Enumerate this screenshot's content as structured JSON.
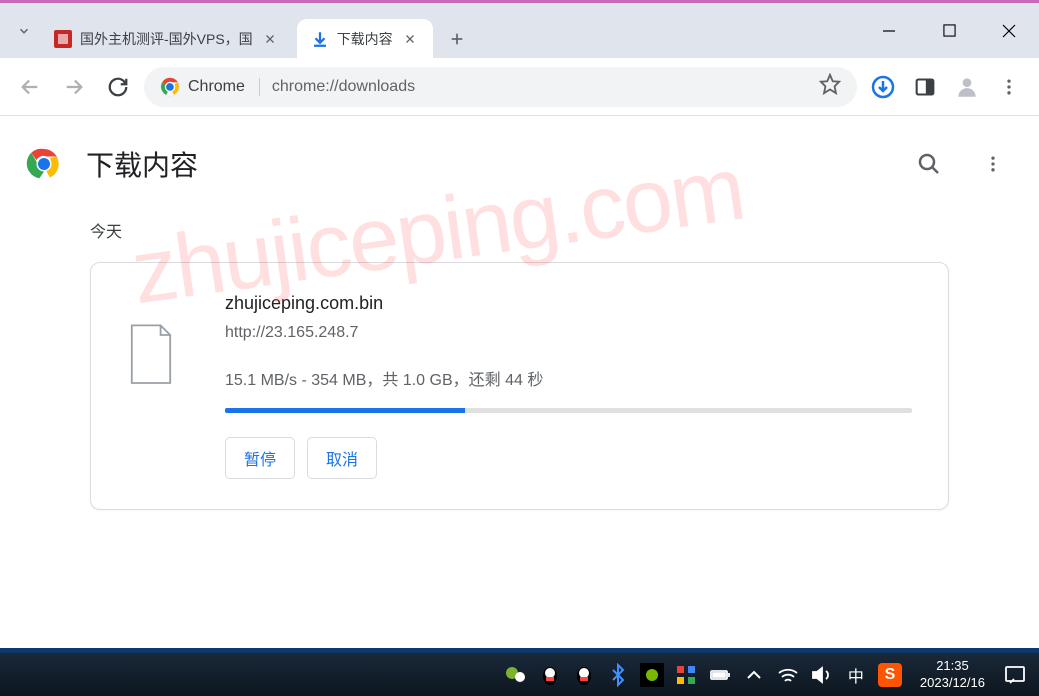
{
  "window": {
    "tabs": [
      {
        "title": "国外主机测评-国外VPS，国",
        "favicon": "red"
      },
      {
        "title": "下载内容",
        "favicon": "download"
      }
    ]
  },
  "addressbar": {
    "site_label": "Chrome",
    "url": "chrome://downloads"
  },
  "downloads": {
    "page_title": "下载内容",
    "date_label": "今天",
    "item": {
      "filename": "zhujiceping.com.bin",
      "url": "http://23.165.248.7",
      "status": "15.1 MB/s - 354 MB，共 1.0 GB，还剩 44 秒",
      "progress_percent": 35,
      "pause_label": "暂停",
      "cancel_label": "取消"
    }
  },
  "watermark": "zhujiceping.com",
  "taskbar": {
    "lang": "中",
    "time": "21:35",
    "date": "2023/12/16"
  }
}
